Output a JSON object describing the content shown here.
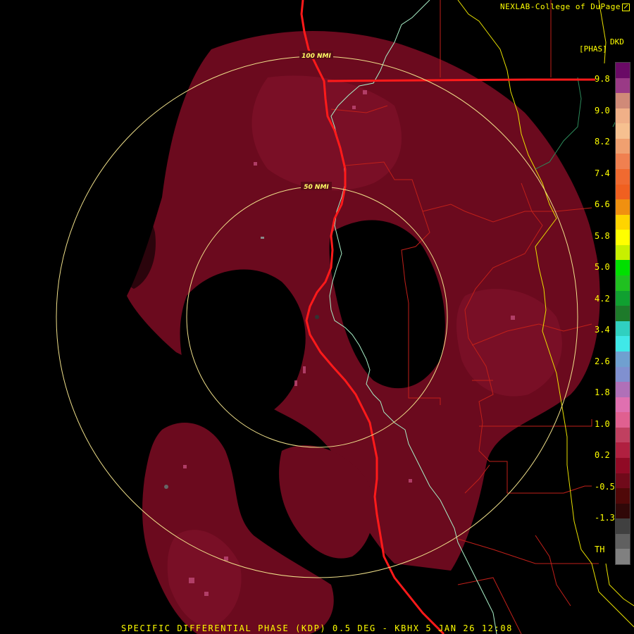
{
  "header": {
    "credit": "NEXLAB-College of DuPage"
  },
  "legend": {
    "product_code": "DKD",
    "unit": "[PHAS]",
    "ticks": [
      "9.8",
      "9.0",
      "8.2",
      "7.4",
      "6.6",
      "5.8",
      "5.0",
      "4.2",
      "3.4",
      "2.6",
      "1.8",
      "1.0",
      "0.2",
      "-0.5",
      "-1.3",
      "TH"
    ],
    "colors": [
      "#6a0a66",
      "#9a3a86",
      "#d08a78",
      "#f0b088",
      "#f6c090",
      "#f0a070",
      "#f08050",
      "#f06a30",
      "#f06020",
      "#f09010",
      "#ffd400",
      "#ffff00",
      "#c8f000",
      "#00e000",
      "#20c020",
      "#10a030",
      "#1d7a2a",
      "#30d0c0",
      "#40e8e8",
      "#70a0d0",
      "#8090d0",
      "#b070b8",
      "#e070b0",
      "#e06090",
      "#c04060",
      "#b02040",
      "#900a25",
      "#700a1a",
      "#500808",
      "#300808",
      "#404040",
      "#606060",
      "#808080"
    ]
  },
  "rings": [
    {
      "label": "100 NMI"
    },
    {
      "label": "50 NMI"
    }
  ],
  "footer": {
    "caption": "SPECIFIC DIFFERENTIAL PHASE (KDP) 0.5 DEG - KBHX 5 JAN 26 12:08"
  }
}
